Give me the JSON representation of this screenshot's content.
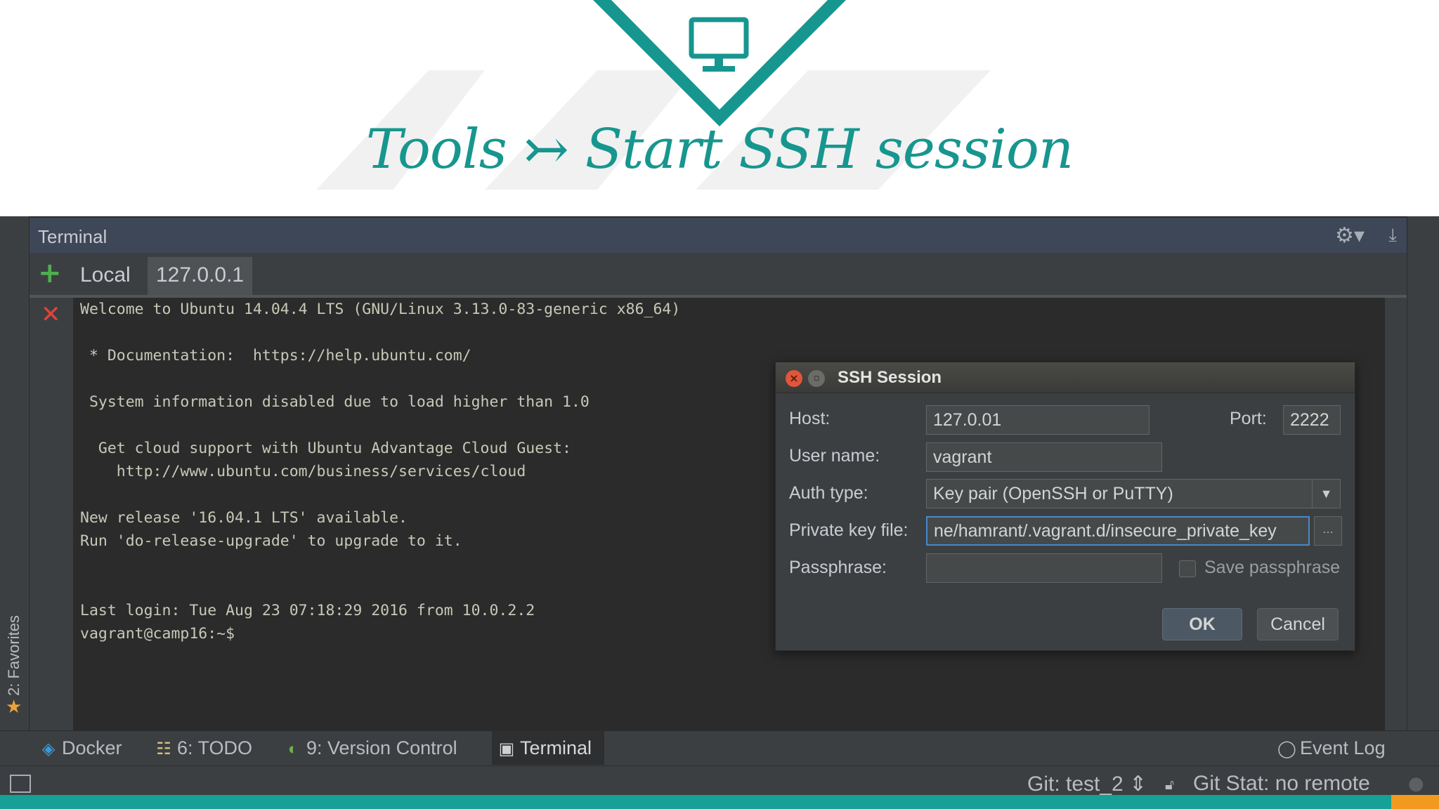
{
  "slide": {
    "title": "Tools ↣ Start SSH session",
    "accent_color": "#17968f"
  },
  "tool_window": {
    "title": "Terminal",
    "tabs": [
      {
        "label": "Local"
      },
      {
        "label": "127.0.0.1"
      }
    ]
  },
  "terminal": {
    "lines": [
      "Welcome to Ubuntu 14.04.4 LTS (GNU/Linux 3.13.0-83-generic x86_64)",
      " * Documentation:  https://help.ubuntu.com/",
      " System information disabled due to load higher than 1.0",
      "  Get cloud support with Ubuntu Advantage Cloud Guest:",
      "    http://www.ubuntu.com/business/services/cloud",
      "New release '16.04.1 LTS' available.",
      "Run 'do-release-upgrade' to upgrade to it.",
      "Last login: Tue Aug 23 07:18:29 2016 from 10.0.2.2",
      "vagrant@camp16:~$"
    ]
  },
  "dialog": {
    "title": "SSH Session",
    "host_label": "Host:",
    "host_value": "127.0.01",
    "port_label": "Port:",
    "port_value": "2222",
    "username_label": "User name:",
    "username_value": "vagrant",
    "auth_label": "Auth type:",
    "auth_value": "Key pair (OpenSSH or PuTTY)",
    "keyfile_label": "Private key file:",
    "keyfile_value": "ne/hamrant/.vagrant.d/insecure_private_key",
    "browse_label": "...",
    "passphrase_label": "Passphrase:",
    "passphrase_value": "",
    "save_passphrase_label": "Save passphrase",
    "ok_label": "OK",
    "cancel_label": "Cancel"
  },
  "sidebar": {
    "favorites_label": "2: Favorites"
  },
  "tool_strip": {
    "items": [
      {
        "label": "Docker",
        "icon": "docker-icon"
      },
      {
        "label": "6: TODO",
        "icon": "todo-icon"
      },
      {
        "label": "9: Version Control",
        "icon": "version-control-icon"
      },
      {
        "label": "Terminal",
        "icon": "terminal-icon"
      }
    ],
    "event_log": "Event Log"
  },
  "status_bar": {
    "git_branch": "Git: test_2 ⇕",
    "git_status": "Git Stat: no remote"
  }
}
